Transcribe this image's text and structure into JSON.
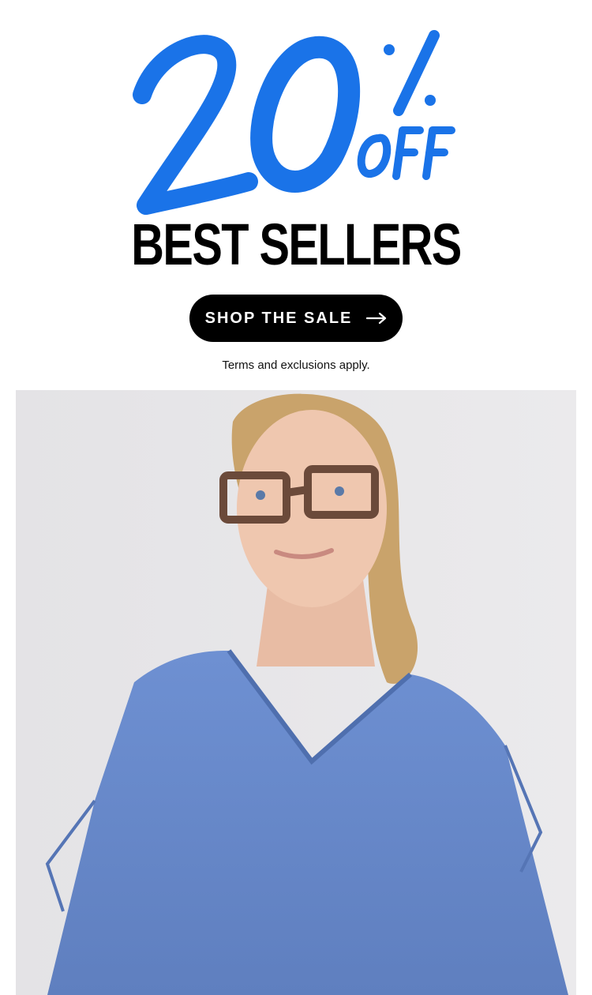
{
  "promo": {
    "discount": "20%",
    "discount_suffix": "OFF",
    "headline": "BEST SELLERS",
    "accent_color": "#1a73e8"
  },
  "cta": {
    "label": "SHOP THE SALE",
    "icon": "arrow-right-icon"
  },
  "terms": "Terms and exclusions apply.",
  "image": {
    "subject": "model-wearing-blue-scrub-top",
    "scrub_color": "#6f8fcf"
  }
}
